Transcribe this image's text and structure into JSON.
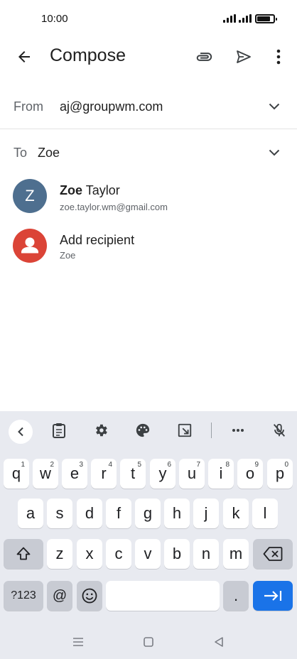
{
  "status": {
    "time": "10:00"
  },
  "appbar": {
    "title": "Compose"
  },
  "from": {
    "label": "From",
    "value": "aj@groupwm.com"
  },
  "to": {
    "label": "To",
    "value": "Zoe"
  },
  "suggestions": [
    {
      "initial": "Z",
      "name_match": "Zoe",
      "name_rest": " Taylor",
      "email": "zoe.taylor.wm@gmail.com",
      "color": "#4e6f8f"
    },
    {
      "name": "Add recipient",
      "sub": "Zoe",
      "color": "#db4437"
    }
  ],
  "keyboard": {
    "row1": [
      {
        "k": "q",
        "n": "1"
      },
      {
        "k": "w",
        "n": "2"
      },
      {
        "k": "e",
        "n": "3"
      },
      {
        "k": "r",
        "n": "4"
      },
      {
        "k": "t",
        "n": "5"
      },
      {
        "k": "y",
        "n": "6"
      },
      {
        "k": "u",
        "n": "7"
      },
      {
        "k": "i",
        "n": "8"
      },
      {
        "k": "o",
        "n": "9"
      },
      {
        "k": "p",
        "n": "0"
      }
    ],
    "row2": [
      "a",
      "s",
      "d",
      "f",
      "g",
      "h",
      "j",
      "k",
      "l"
    ],
    "row3": [
      "z",
      "x",
      "c",
      "v",
      "b",
      "n",
      "m"
    ],
    "symbols": "?123",
    "at": "@",
    "period": "."
  },
  "colors": {
    "accent": "#1a73e8",
    "keyboard_bg": "#e8eaf0"
  }
}
